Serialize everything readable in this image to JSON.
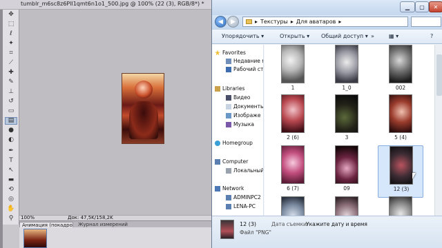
{
  "photoshop": {
    "title": "tumblr_m6sc8z6Pll1qmt6n1o1_500.jpg @ 100% (22 (3), RGB/8*) *",
    "statusbar": {
      "zoom": "100%",
      "doc_info": "Док: 47,5K/158,2K"
    },
    "panel_tabs": [
      "Анимация (покадровая)",
      "Журнал измерений"
    ]
  },
  "explorer": {
    "address": {
      "part1": "Текстуры",
      "part2": "Для аватаров"
    },
    "toolbar": {
      "organize": "Упорядочить ▾",
      "open": "Открыть ▾",
      "share": "Общий доступ ▾",
      "more": "»"
    },
    "nav": {
      "favorites": "Favorites",
      "recent": "Недавние м",
      "desktop": "Рабочий ст",
      "libraries": "Libraries",
      "video": "Видео",
      "documents": "Документы",
      "images": "Изображе",
      "music": "Музыка",
      "homegroup": "Homegroup",
      "computer": "Computer",
      "local": "Локальный",
      "network": "Network",
      "pc1": "ADMINPC2",
      "pc2": "LENA-PC"
    },
    "files": [
      "1",
      "1_0",
      "002",
      "2 (6)",
      "3",
      "5 (4)",
      "6 (7)",
      "09",
      "12 (3)",
      "",
      "",
      ""
    ],
    "details": {
      "name": "12 (3)",
      "date_label": "Дата съемки:",
      "date_value": "Укажите дату и время",
      "type": "Файл \"PNG\""
    }
  }
}
